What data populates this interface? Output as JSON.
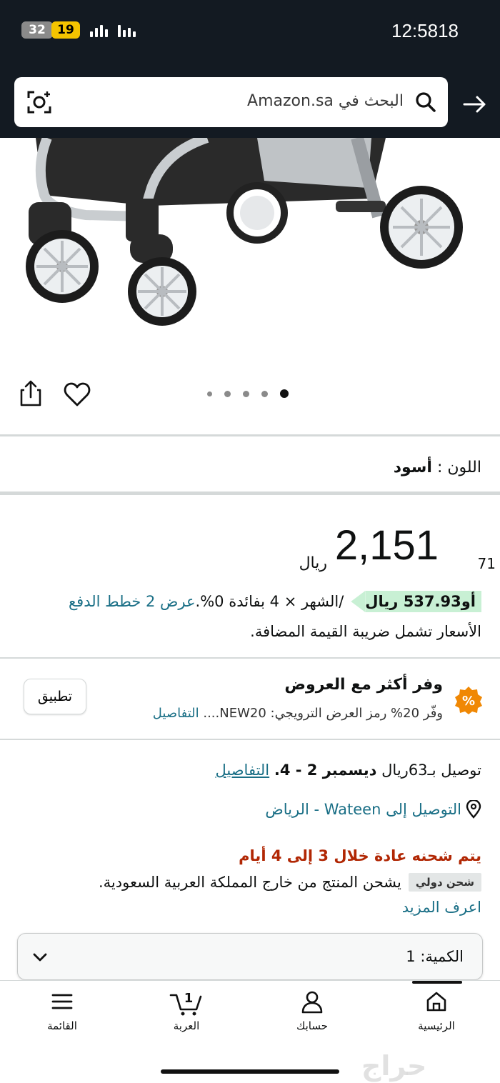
{
  "status_bar": {
    "badge_gray": "32",
    "badge_yellow": "19",
    "time": "12:5818"
  },
  "search": {
    "placeholder": "البحث في Amazon.sa"
  },
  "gallery": {
    "image_count": 5,
    "active_index": 4
  },
  "color": {
    "label": "اللون :",
    "value": "أسود"
  },
  "price": {
    "whole": "2,151",
    "fraction": "71",
    "currency": "ريال"
  },
  "installments": {
    "prefix": "أو",
    "amount": "537.93 ريال",
    "per_month": "/الشهر × 4 بفائدة 0%.",
    "link": "عرض 2 خطط الدفع"
  },
  "vat_note": ".الأسعار تشمل ضريبة القيمة المضافة",
  "offer": {
    "badge": "%",
    "title": "وفر أكثر مع العروض",
    "subtitle": "وفّر 20% رمز العرض الترويجي: NEW20....",
    "details_link": "التفاصيل",
    "apply_button": "تطبيق"
  },
  "delivery": {
    "text": "توصيل بـ63ريال",
    "date": "ديسمبر 2 - 4.",
    "details_link": "التفاصيل",
    "location": "التوصيل إلى Wateen - الرياض",
    "shipping_time": "يتم شحنه عادة خلال 3 إلى 4 أيام",
    "intl_badge": "شحن دولي",
    "intl_text": "يشحن المنتج من خارج المملكة العربية السعودية.",
    "learn_more": "اعرف المزيد"
  },
  "quantity": {
    "label": "الكمية:",
    "value": "1"
  },
  "bottom_nav": {
    "home": "الرئيسية",
    "account": "حسابك",
    "cart": "العربة",
    "cart_count": "1",
    "menu": "القائمة"
  },
  "watermark": "حراج",
  "colors": {
    "header_bg": "#131a22",
    "link": "#1a6f86",
    "deal_red": "#b12704",
    "installment_highlight": "#c8f0d4",
    "offer_badge": "#f08804"
  },
  "icons": [
    "search-icon",
    "camera-icon",
    "back-arrow-icon",
    "share-icon",
    "heart-icon",
    "location-pin-icon",
    "chevron-down-icon",
    "home-icon",
    "account-icon",
    "cart-icon",
    "menu-icon"
  ]
}
